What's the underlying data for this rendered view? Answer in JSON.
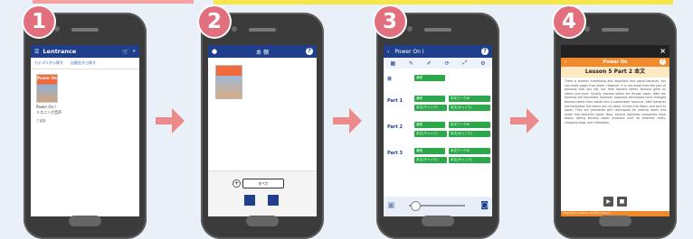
{
  "steps": [
    "1",
    "2",
    "3",
    "4"
  ],
  "colors": {
    "accent_blue": "#1f3f8c",
    "step_pink": "#e26f7d",
    "green": "#2aa84a",
    "orange": "#f08a2e"
  },
  "screen1": {
    "brand": "Lentrance",
    "tabs": [
      "カテゴリから探す",
      "出版社から探す"
    ],
    "book_cover_title": "Power On",
    "book_name_lines": [
      "Power On I",
      "リスニング音声"
    ],
    "publisher": "三省堂"
  },
  "screen2": {
    "title": "本 棚",
    "filter_label": "すべて",
    "plus": "+",
    "help": "?"
  },
  "screen3": {
    "title": "Power On I",
    "help": "?",
    "rows": [
      {
        "label": "目",
        "buttons": [
          "通常"
        ]
      },
      {
        "label": "Part 1",
        "buttons": [
          "通常",
          "本文ワークW",
          "本文(チャンク)",
          "本文(ゆっくり)"
        ]
      },
      {
        "label": "Part 2",
        "buttons": [
          "通常",
          "本文ワークW",
          "本文(チャンク)",
          "本文(ゆっくり)"
        ]
      },
      {
        "label": "Part 3",
        "buttons": [
          "通常",
          "本文ワークW",
          "本文(チャンク)",
          "本文(ゆっくり)"
        ]
      }
    ]
  },
  "screen4": {
    "close": "×",
    "title": "Power On",
    "help": "?",
    "lesson": "Lesson 5  Part 2  本文",
    "body": "There is another interesting and important fact about bananas. You can make paper from them. However, it is not made from the part of bananas that you eat, but from banana stems. Banana grow on stems just once. Usually, banana stems are thrown away, after the bananas are harvested. However, Japanese techniques have changed banana stems from waste into a sustainable resource. After bananas are harvested, the stems are cut down, turned into fibers, and sent to Japan. They are processed with techniques for making washi and made into beautiful paper. Now, several Japanese companies have begun selling banana paper products such as business cards, shopping bags, and notebooks.",
    "controls": [
      "▶",
      "■"
    ],
    "footer": "Copyright(C) Sanseido. All rights reserved."
  }
}
